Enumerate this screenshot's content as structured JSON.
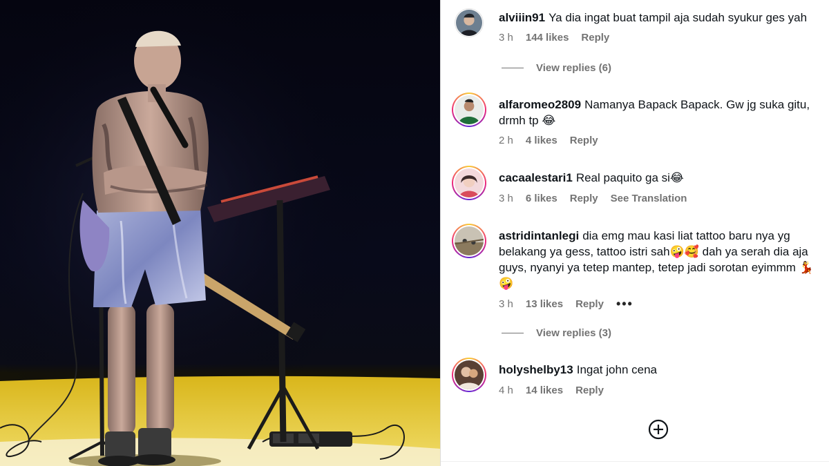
{
  "photo": {
    "alt_subject": "concert-performer-photo"
  },
  "comments": [
    {
      "username": "alviiin91",
      "text": "Ya dia ingat buat tampil aja sudah syukur ges yah",
      "time": "3 h",
      "likes": "144 likes",
      "reply": "Reply",
      "translate": "",
      "has_more": false,
      "view_replies": "View replies (6)"
    },
    {
      "username": "alfaromeo2809",
      "text": "Namanya Bapack Bapack. Gw jg suka gitu, drmh tp 😂",
      "time": "2 h",
      "likes": "4 likes",
      "reply": "Reply",
      "translate": "",
      "has_more": false,
      "view_replies": ""
    },
    {
      "username": "cacaalestari1",
      "text": "Real paquito ga si😂",
      "time": "3 h",
      "likes": "6 likes",
      "reply": "Reply",
      "translate": "See Translation",
      "has_more": false,
      "view_replies": ""
    },
    {
      "username": "astridintanlegi",
      "text": "dia emg mau kasi liat tattoo baru nya yg belakang ya gess, tattoo istri sah🤪🥰 dah ya serah dia aja guys, nyanyi ya tetep mantep, tetep jadi sorotan eyimmm 💃 🤪",
      "time": "3 h",
      "likes": "13 likes",
      "reply": "Reply",
      "translate": "",
      "has_more": true,
      "view_replies": "View replies (3)"
    },
    {
      "username": "holyshelby13",
      "text": "Ingat john cena",
      "time": "4 h",
      "likes": "14 likes",
      "reply": "Reply",
      "translate": "",
      "has_more": false,
      "view_replies": ""
    }
  ],
  "more_dots": "•••",
  "icons": {
    "add": "plus-circle-icon"
  },
  "colors": {
    "meta": "#737373",
    "text": "#0f1419",
    "stage": "#e6c01e"
  }
}
